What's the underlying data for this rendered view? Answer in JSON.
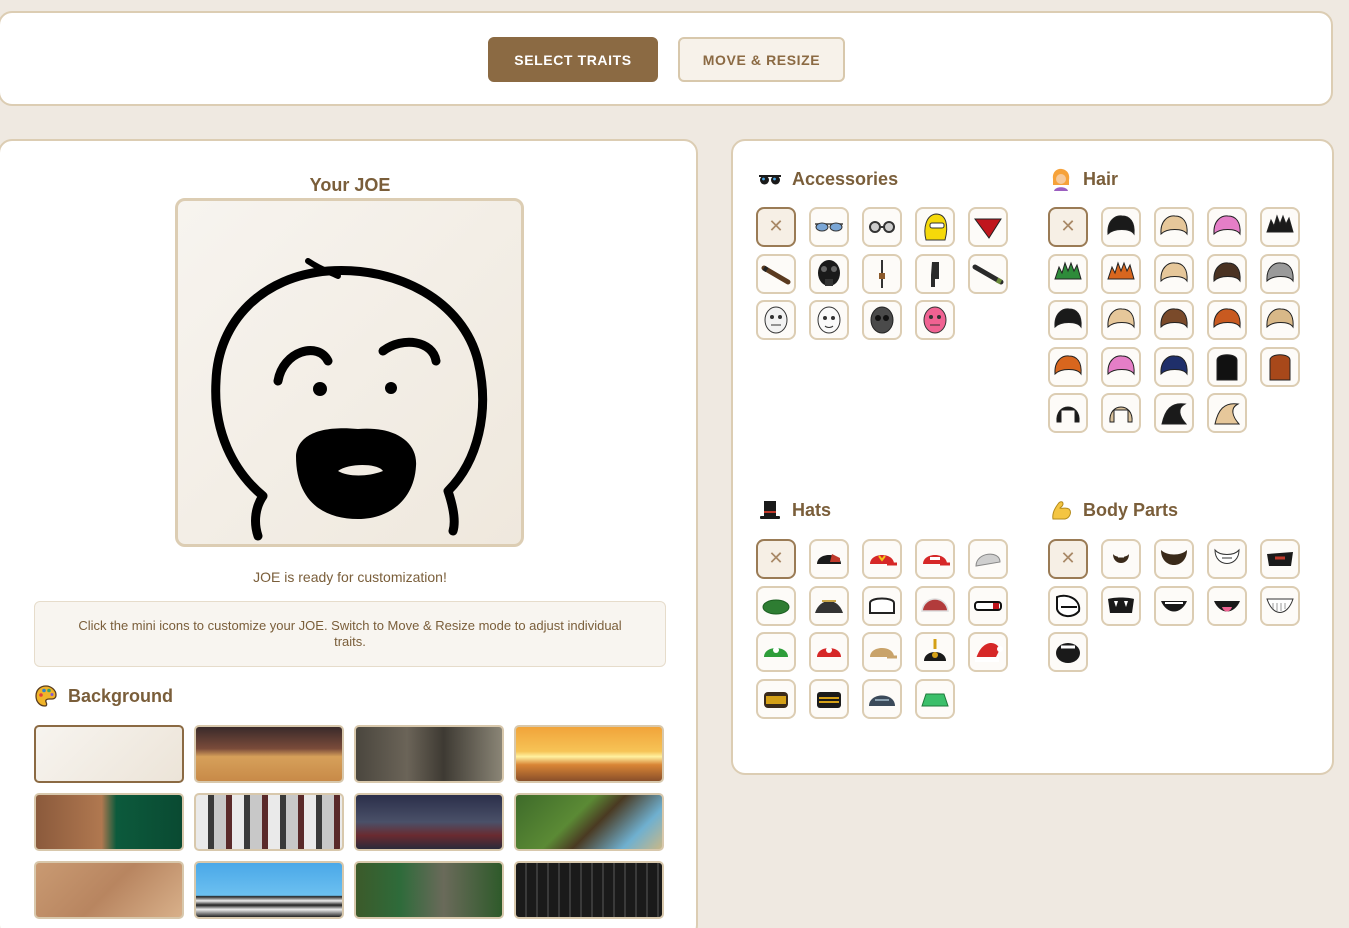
{
  "modes": {
    "select_traits": "SELECT TRAITS",
    "move_resize": "MOVE & RESIZE"
  },
  "preview": {
    "title": "Your JOE",
    "status": "JOE is ready for customization!",
    "hint": "Click the mini icons to customize your JOE. Switch to Move & Resize mode to adjust individual traits."
  },
  "background": {
    "title": "Background",
    "tiles": [
      {
        "name": "plain"
      },
      {
        "name": "basketball-court"
      },
      {
        "name": "restroom"
      },
      {
        "name": "sunset"
      },
      {
        "name": "rolex-store"
      },
      {
        "name": "clothing-store"
      },
      {
        "name": "street-shop"
      },
      {
        "name": "minecraft"
      },
      {
        "name": "de-dust"
      },
      {
        "name": "mario-castle"
      },
      {
        "name": "gang-street"
      },
      {
        "name": "jail-cell"
      }
    ]
  },
  "sections": {
    "accessories": {
      "title": "Accessories",
      "items": [
        "none",
        "aviator-sunglasses",
        "round-glasses",
        "yellow-balaclava",
        "red-bandana",
        "cigar",
        "gas-mask",
        "ak47",
        "pistol",
        "cigarette",
        "mask-white-1",
        "mask-white-2",
        "mask-grey",
        "mask-pink"
      ]
    },
    "hair": {
      "title": "Hair",
      "items": [
        "none",
        "black-short",
        "blonde-short",
        "pink-short",
        "black-spiky",
        "green-mohawk",
        "orange-spiky",
        "blonde-swept",
        "brown-swept",
        "grey-swept",
        "black-bowl",
        "blonde-messy",
        "brown-messy",
        "ginger-messy",
        "blonde-flat",
        "orange-flat",
        "pink-flat",
        "blue-flat",
        "black-long",
        "auburn-long",
        "black-bob",
        "blonde-bob",
        "black-quiff",
        "blonde-quiff"
      ]
    },
    "hats": {
      "title": "Hats",
      "items": [
        "none",
        "black-cap",
        "mcdonalds-cap",
        "maga-cap",
        "grey-beanie",
        "green-beret",
        "bicorne",
        "white-cap",
        "red-bandana-hat",
        "ski-goggles",
        "luigi-cap",
        "mario-cap",
        "police-cap",
        "pickelhaube",
        "santa-hat",
        "gold-ushanka",
        "gold-crown-hat",
        "navy-ushanka",
        "green-bucket"
      ]
    },
    "body_parts": {
      "title": "Body Parts",
      "items": [
        "none",
        "goatee",
        "full-beard",
        "white-beard",
        "angry-mouth",
        "troll-face",
        "fangs",
        "grin",
        "tongue",
        "teeth-grin",
        "open-mouth"
      ]
    }
  },
  "colors": {
    "accent": "#8b6a43",
    "border": "#dccdb3",
    "page": "#efe9e1"
  }
}
